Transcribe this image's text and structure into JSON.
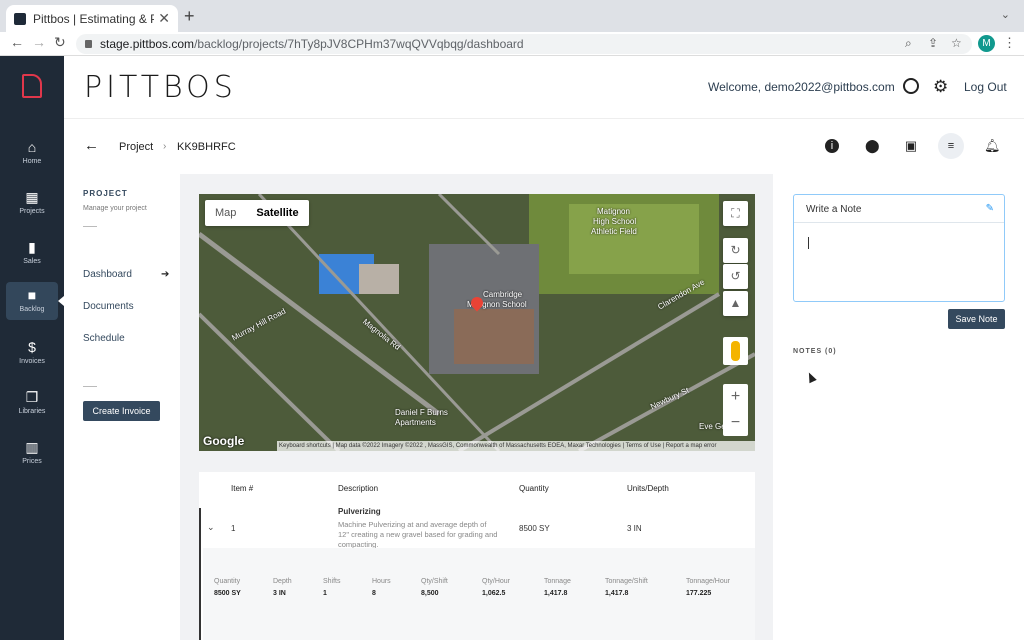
{
  "browser": {
    "tab_title": "Pittbos | Estimating & Proposal",
    "tab_close": "✕",
    "new_tab": "+",
    "url_host": "stage.pittbos.com",
    "url_path": "/backlog/projects/7hTy8pJV8CPHm37wqQVVqbqg/dashboard",
    "profile_initial": "M"
  },
  "sidebar": {
    "items": [
      {
        "label": "Home",
        "icon": "home-icon",
        "glyph": "⌂"
      },
      {
        "label": "Projects",
        "icon": "grid-icon",
        "glyph": "▦"
      },
      {
        "label": "Sales",
        "icon": "bar-chart-icon",
        "glyph": "▮"
      },
      {
        "label": "Backlog",
        "icon": "briefcase-icon",
        "glyph": "■"
      },
      {
        "label": "Invoices",
        "icon": "dollar-icon",
        "glyph": "$"
      },
      {
        "label": "Libraries",
        "icon": "book-icon",
        "glyph": "❐"
      },
      {
        "label": "Prices",
        "icon": "building-icon",
        "glyph": "▥"
      }
    ],
    "active_index": 3
  },
  "header": {
    "brand": "PITTBOS",
    "welcome": "Welcome, demo2022@pittbos.com",
    "logout": "Log Out"
  },
  "breadcrumb": {
    "root": "Project",
    "sep": "›",
    "current": "KK9BHRFC"
  },
  "pagenav": {
    "title": "PROJECT",
    "subtitle": "Manage your project",
    "links": [
      "Dashboard",
      "Documents",
      "Schedule"
    ],
    "create_invoice": "Create Invoice"
  },
  "map": {
    "type_map": "Map",
    "type_satellite": "Satellite",
    "selected_type": "Satellite",
    "google": "Google",
    "attribution": "Keyboard shortcuts  |  Map data ©2022 Imagery ©2022 , MassGIS, Commonwealth of Massachusetts EOEA, Maxar Technologies  |  Terms of Use  |  Report a map error",
    "labels": [
      {
        "text": "Matignon",
        "cls": "l1"
      },
      {
        "text": "High School",
        "cls": "l2"
      },
      {
        "text": "Athletic Field",
        "cls": "l3"
      },
      {
        "text": "Cambridge",
        "cls": "l4"
      },
      {
        "text": "Matignon School",
        "cls": "l5"
      },
      {
        "text": "Murray Hill Road",
        "cls": "l6"
      },
      {
        "text": "Magnolia Rd",
        "cls": "l7"
      },
      {
        "text": "Daniel F Burns",
        "cls": "l8"
      },
      {
        "text": "Apartments",
        "cls": "l9"
      },
      {
        "text": "Clarendon Ave",
        "cls": "l10"
      },
      {
        "text": "Newbury St",
        "cls": "l11"
      },
      {
        "text": "Eve Gen",
        "cls": "l12"
      }
    ]
  },
  "table": {
    "headers": [
      "Item #",
      "Description",
      "Quantity",
      "Units/Depth"
    ],
    "row": {
      "item": "1",
      "title": "Pulverizing",
      "description": "Machine Pulverizing at and average depth of 12\" creating a new gravel based for grading and compacting.",
      "quantity": "8500 SY",
      "units": "3 IN"
    },
    "detail_headers": [
      "Quantity",
      "Depth",
      "Shifts",
      "Hours",
      "Qty/Shift",
      "Qty/Hour",
      "Tonnage",
      "Tonnage/Shift",
      "Tonnage/Hour"
    ],
    "detail_values": [
      "8500 SY",
      "3 IN",
      "1",
      "8",
      "8,500",
      "1,062.5",
      "1,417.8",
      "1,417.8",
      "177.225"
    ]
  },
  "notes": {
    "write_label": "Write a Note",
    "save": "Save Note",
    "count_label": "NOTES (0)"
  },
  "colors": {
    "sidebar": "#1f2a37",
    "button": "#34495e",
    "accent": "#2196f3"
  }
}
